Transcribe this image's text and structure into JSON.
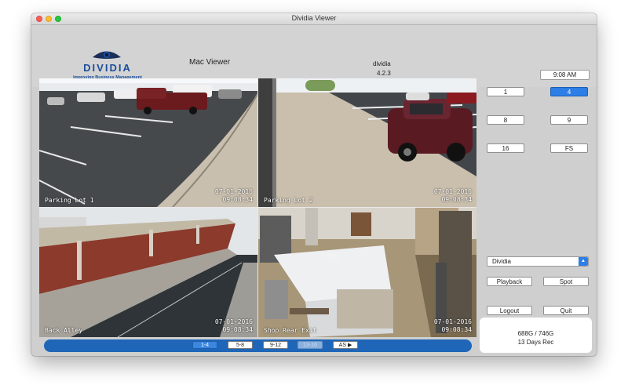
{
  "window": {
    "title": "Dividia Viewer"
  },
  "header": {
    "brand": "DIVIDIA",
    "tagline": "Improving Business Management",
    "viewer_label": "Mac Viewer",
    "app_name": "dividia",
    "version": "4.2.3",
    "clock": "9:08 AM"
  },
  "cameras": [
    {
      "name": "Parking Lot 1",
      "date": "07-01-2016",
      "time": "09:08:34"
    },
    {
      "name": "Parking Lot 2",
      "date": "07-01-2016",
      "time": "09:08:34"
    },
    {
      "name": "Back Alley",
      "date": "07-01-2016",
      "time": "09:08:34"
    },
    {
      "name": "Shop Rear Exit",
      "date": "07-01-2016",
      "time": "09:08:34"
    }
  ],
  "pagebar": {
    "buttons": [
      "1-4",
      "5-8",
      "9-12",
      "13-16",
      "AS ▶"
    ],
    "active": "1-4",
    "disabled": "13-16"
  },
  "layout_buttons": [
    "1",
    "4",
    "8",
    "9",
    "16",
    "FS"
  ],
  "active_layout": "4",
  "site_select": {
    "value": "Dividia"
  },
  "actions": {
    "playback": "Playback",
    "spot": "Spot",
    "logout": "Logout",
    "quit": "Quit"
  },
  "storage": {
    "usage": "688G / 746G",
    "retention": "13 Days Rec"
  },
  "colors": {
    "accent": "#2d7ee6",
    "pagebar": "#1f66b8",
    "brand": "#1a4d9a"
  }
}
